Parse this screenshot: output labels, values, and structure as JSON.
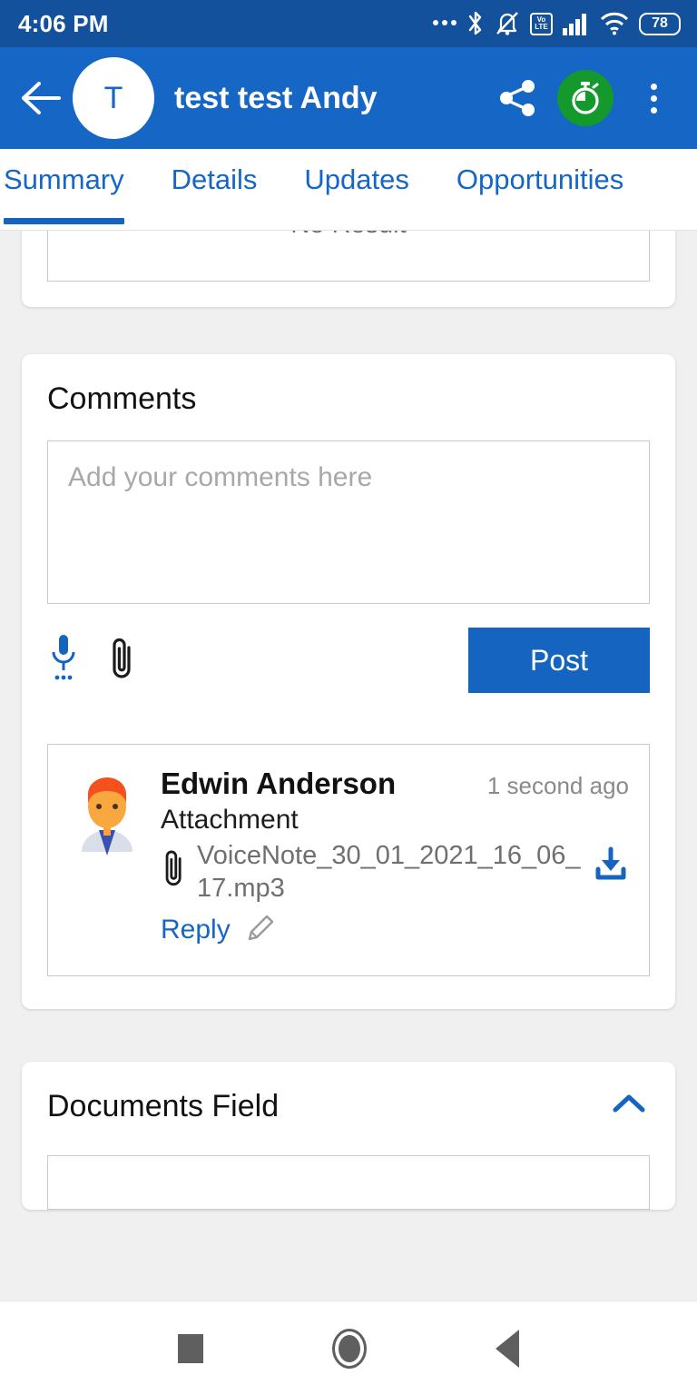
{
  "status_bar": {
    "time": "4:06 PM",
    "battery_level": "78",
    "volte_top": "Vo",
    "volte_bottom": "LTE",
    "icons": [
      "more-dots-icon",
      "bluetooth-icon",
      "notifications-muted-icon",
      "volte-icon",
      "cellular-signal-icon",
      "wifi-icon",
      "battery-icon"
    ]
  },
  "app_bar": {
    "back_icon": "back-arrow-icon",
    "avatar_initial": "T",
    "title": "test test Andy",
    "share_icon": "share-icon",
    "timer_icon": "stopwatch-icon",
    "overflow_icon": "overflow-menu-icon"
  },
  "tabs": [
    {
      "label": "Summary",
      "active": true
    },
    {
      "label": "Details",
      "active": false
    },
    {
      "label": "Updates",
      "active": false
    },
    {
      "label": "Opportunities",
      "active": false
    }
  ],
  "results_card": {
    "empty_text": "No Result"
  },
  "comments": {
    "title": "Comments",
    "input_placeholder": "Add your comments here",
    "input_value": "",
    "mic_icon": "microphone-icon",
    "attach_icon": "paperclip-icon",
    "post_label": "Post",
    "items": [
      {
        "avatar": "user-avatar-illustration",
        "author": "Edwin Anderson",
        "timestamp": "1 second ago",
        "subject": "Attachment",
        "attachment_icon": "paperclip-icon",
        "attachment_name": "VoiceNote_30_01_2021_16_06_17.mp3",
        "download_icon": "download-icon",
        "reply_label": "Reply",
        "edit_icon": "pencil-icon"
      }
    ]
  },
  "documents_field": {
    "title": "Documents Field",
    "collapse_icon": "chevron-up-icon",
    "input_value": ""
  },
  "nav_bar": {
    "recents_icon": "recents-square-icon",
    "home_icon": "home-circle-icon",
    "back_icon": "back-triangle-icon"
  },
  "colors": {
    "status_bar": "#13519c",
    "app_bar": "#1566c5",
    "accent_blue": "#1565c0",
    "timer_green": "#14992c",
    "page_background": "#f0f0f0"
  }
}
